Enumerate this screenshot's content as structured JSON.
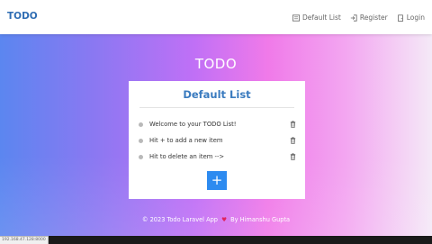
{
  "navbar": {
    "brand": "TODO",
    "links": [
      {
        "label": "Default List",
        "icon": "list-icon"
      },
      {
        "label": "Register",
        "icon": "register-icon"
      },
      {
        "label": "Login",
        "icon": "login-icon"
      }
    ]
  },
  "page": {
    "heading": "TODO"
  },
  "list": {
    "title": "Default List",
    "items": [
      {
        "text": "Welcome to your TODO List!"
      },
      {
        "text": "Hit + to add a new item"
      },
      {
        "text": "Hit to delete an item -->"
      }
    ],
    "add_label": "+"
  },
  "footer": {
    "prefix": "© 2023 Todo Laravel App",
    "suffix": "By Himanshu Gupta"
  },
  "status_bar": {
    "url": "192.168.47.128:8000"
  },
  "colors": {
    "brand": "#2f6db3",
    "title": "#3a7bbf",
    "add_button": "#2d8bf0",
    "heart": "#e0245e"
  }
}
